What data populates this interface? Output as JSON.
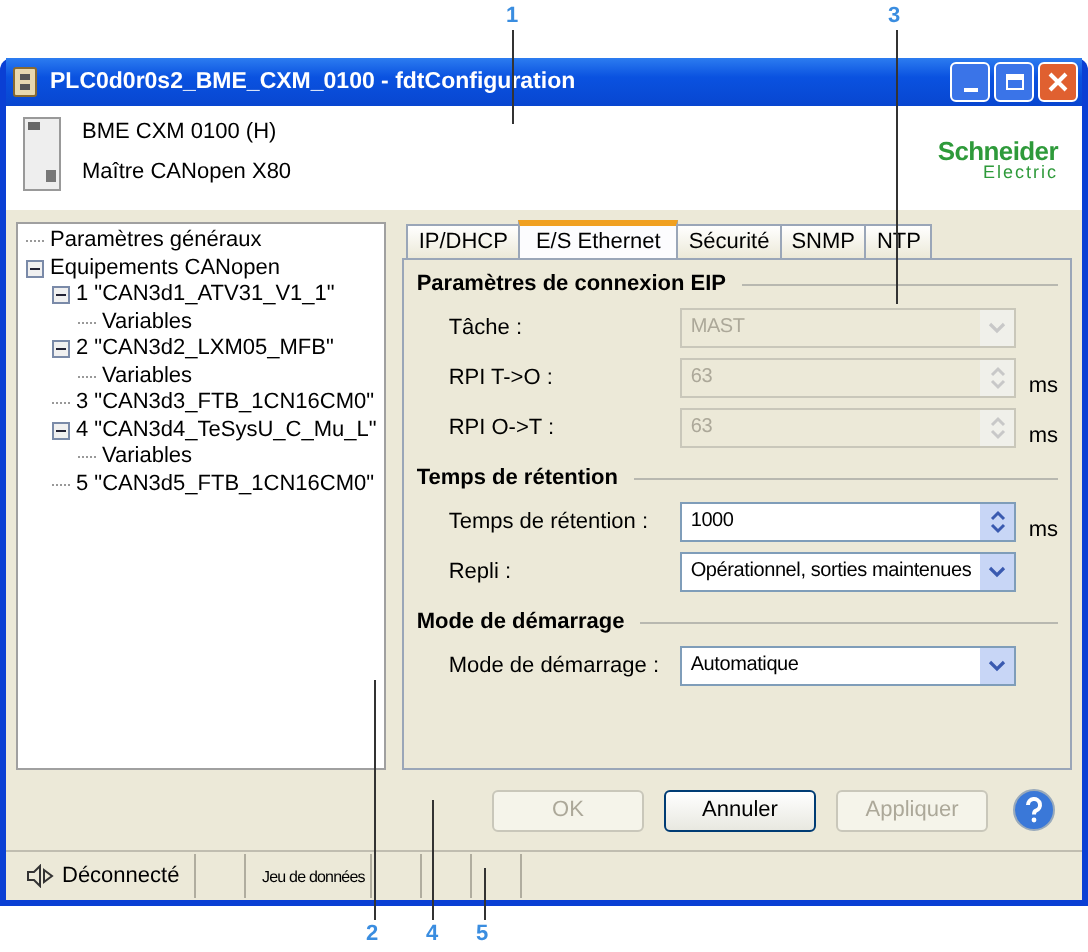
{
  "callouts": [
    {
      "label": "1"
    },
    {
      "label": "3"
    },
    {
      "label": "2"
    },
    {
      "label": "4"
    },
    {
      "label": "5"
    }
  ],
  "window": {
    "title": "PLC0d0r0s2_BME_CXM_0100 - fdtConfiguration"
  },
  "header": {
    "device": "BME CXM 0100 (H)",
    "description": "Maître CANopen X80",
    "logo_top": "Schneider",
    "logo_bottom": "Electric"
  },
  "tree": [
    {
      "label": "Paramètres généraux"
    },
    {
      "label": "Equipements CANopen",
      "expanded": true,
      "children": [
        {
          "label": "1 \"CAN3d1_ATV31_V1_1\"",
          "expanded": true,
          "children": [
            {
              "label": "Variables"
            }
          ]
        },
        {
          "label": "2 \"CAN3d2_LXM05_MFB\"",
          "expanded": true,
          "children": [
            {
              "label": "Variables"
            }
          ]
        },
        {
          "label": "3 \"CAN3d3_FTB_1CN16CM0\""
        },
        {
          "label": "4 \"CAN3d4_TeSysU_C_Mu_L\"",
          "expanded": true,
          "children": [
            {
              "label": "Variables"
            }
          ]
        },
        {
          "label": "5 \"CAN3d5_FTB_1CN16CM0\""
        }
      ]
    }
  ],
  "tabs": [
    {
      "label": "IP/DHCP",
      "selected": false
    },
    {
      "label": "E/S Ethernet",
      "selected": true
    },
    {
      "label": "Sécurité",
      "selected": false
    },
    {
      "label": "SNMP",
      "selected": false
    },
    {
      "label": "NTP",
      "selected": false
    }
  ],
  "sections": [
    {
      "title": "Paramètres de connexion EIP",
      "fields": [
        {
          "label": "Tâche :",
          "kind": "combo",
          "value": "MAST",
          "disabled": true
        },
        {
          "label": "RPI T->O :",
          "kind": "spin",
          "value": "63",
          "disabled": true,
          "unit": "ms"
        },
        {
          "label": "RPI O->T :",
          "kind": "spin",
          "value": "63",
          "disabled": true,
          "unit": "ms"
        }
      ]
    },
    {
      "title": "Temps de rétention",
      "fields": [
        {
          "label": "Temps de rétention :",
          "kind": "spin",
          "value": "1000",
          "disabled": false,
          "unit": "ms"
        },
        {
          "label": "Repli :",
          "kind": "combo",
          "value": "Opérationnel, sorties maintenues",
          "disabled": false
        }
      ]
    },
    {
      "title": "Mode de démarrage",
      "fields": [
        {
          "label": "Mode de démarrage :",
          "kind": "combo",
          "value": "Automatique",
          "disabled": false
        }
      ]
    }
  ],
  "buttons": [
    {
      "label": "OK",
      "disabled": true
    },
    {
      "label": "Annuler",
      "disabled": false
    },
    {
      "label": "Appliquer",
      "disabled": true
    }
  ],
  "status_bar": [
    {
      "kind": "connection",
      "text": "Déconnecté"
    },
    {
      "kind": "empty"
    },
    {
      "kind": "dataset",
      "text": "Jeu de données"
    },
    {
      "kind": "empty"
    },
    {
      "kind": "empty"
    },
    {
      "kind": "empty"
    }
  ]
}
